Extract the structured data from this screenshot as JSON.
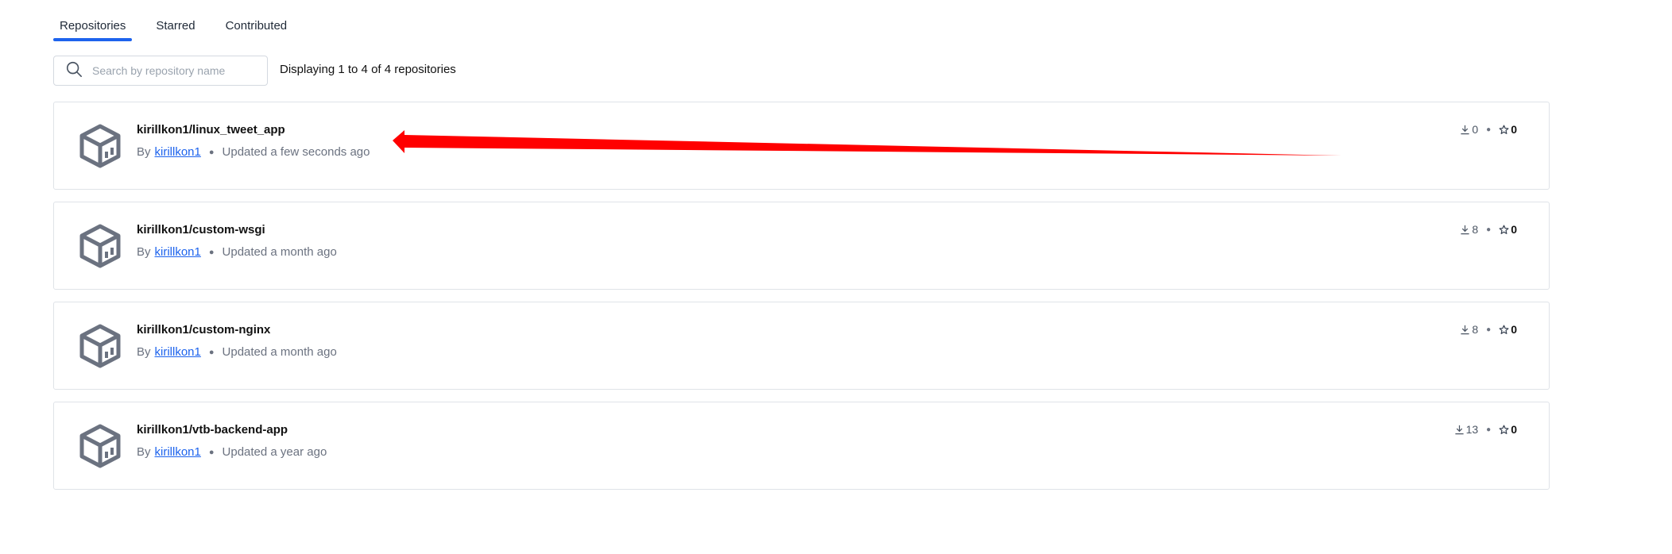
{
  "tabs": [
    {
      "label": "Repositories",
      "active": true
    },
    {
      "label": "Starred",
      "active": false
    },
    {
      "label": "Contributed",
      "active": false
    }
  ],
  "search": {
    "placeholder": "Search by repository name",
    "value": "",
    "icon": "search-icon"
  },
  "display_count": "Displaying 1 to 4 of 4 repositories",
  "repositories": [
    {
      "name": "kirillkon1/linux_tweet_app",
      "by_label": "By",
      "owner": "kirillkon1",
      "updated": "Updated a few seconds ago",
      "pulls": "0",
      "stars": "0"
    },
    {
      "name": "kirillkon1/custom-wsgi",
      "by_label": "By",
      "owner": "kirillkon1",
      "updated": "Updated a month ago",
      "pulls": "8",
      "stars": "0"
    },
    {
      "name": "kirillkon1/custom-nginx",
      "by_label": "By",
      "owner": "kirillkon1",
      "updated": "Updated a month ago",
      "pulls": "8",
      "stars": "0"
    },
    {
      "name": "kirillkon1/vtb-backend-app",
      "by_label": "By",
      "owner": "kirillkon1",
      "updated": "Updated a year ago",
      "pulls": "13",
      "stars": "0"
    }
  ],
  "icons": {
    "repo": "cube-icon",
    "pulls": "download-icon",
    "stars": "star-icon",
    "annotation": "red-arrow-annotation"
  },
  "colors": {
    "accent": "#1d63ed",
    "annotation": "#ff0000",
    "icon": "#6b7280"
  }
}
